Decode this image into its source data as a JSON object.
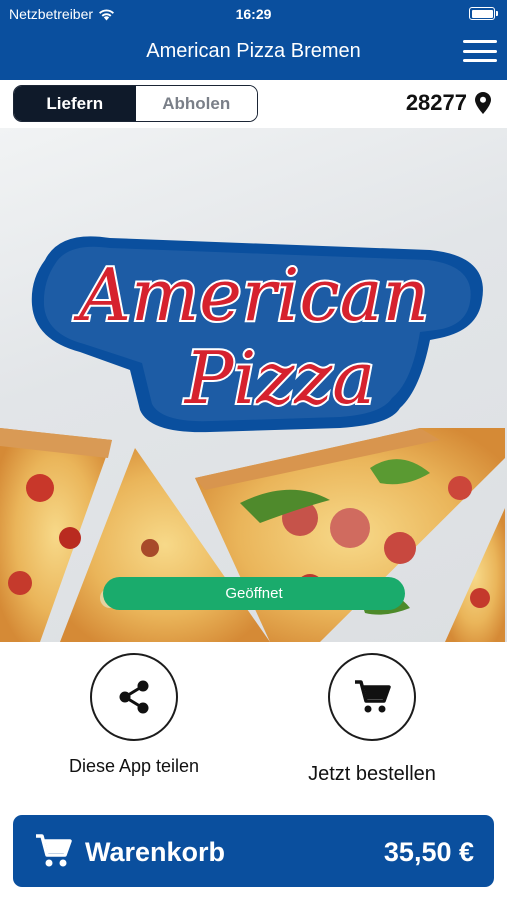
{
  "status_bar": {
    "carrier": "Netzbetreiber",
    "time": "16:29"
  },
  "header": {
    "title": "American Pizza Bremen",
    "menu_icon": "hamburger-menu-icon"
  },
  "order_mode": {
    "options": [
      "Liefern",
      "Abholen"
    ],
    "selected": "Liefern"
  },
  "location": {
    "zip": "28277",
    "icon": "map-pin-icon"
  },
  "hero": {
    "logo_line1": "American",
    "logo_line2": "Pizza",
    "status": "Geöffnet"
  },
  "actions": {
    "share_label": "Diese App teilen",
    "share_icon": "share-icon",
    "order_label": "Jetzt bestellen",
    "order_icon": "shopping-cart-icon"
  },
  "cart": {
    "label": "Warenkorb",
    "total": "35,50 €",
    "icon": "shopping-cart-icon"
  },
  "colors": {
    "brand_blue": "#0a4f9e",
    "logo_red": "#d6222e",
    "open_green": "#1aab6c",
    "segment_dark": "#0f1a2a"
  }
}
